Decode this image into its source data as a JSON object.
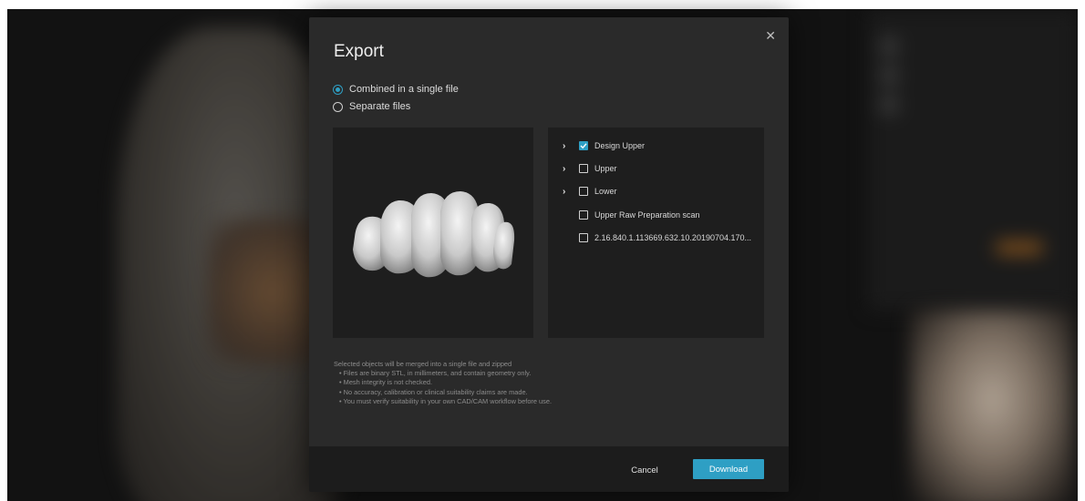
{
  "dialog": {
    "title": "Export",
    "close_icon": "close-icon",
    "export_mode": {
      "options": [
        {
          "label": "Combined in a single file",
          "selected": true
        },
        {
          "label": "Separate files",
          "selected": false
        }
      ]
    },
    "objects": [
      {
        "label": "Design Upper",
        "checked": true,
        "expandable": true
      },
      {
        "label": "Upper",
        "checked": false,
        "expandable": true
      },
      {
        "label": "Lower",
        "checked": false,
        "expandable": true
      },
      {
        "label": "Upper Raw Preparation scan",
        "checked": false,
        "expandable": false
      },
      {
        "label": "2.16.840.1.113669.632.10.20190704.170...",
        "checked": false,
        "expandable": false
      }
    ],
    "notes": {
      "intro": "Selected objects will be merged into a single file and zipped",
      "bullets": [
        "Files are binary STL, in millimeters, and contain geometry only.",
        "Mesh integrity is not checked.",
        "No accuracy, calibration or clinical suitability claims are made.",
        "You must verify suitability in your own CAD/CAM workflow before use."
      ]
    },
    "footer": {
      "cancel_label": "Cancel",
      "download_label": "Download"
    }
  },
  "colors": {
    "accent": "#2e9fc4",
    "dialog_bg": "#2a2a2a",
    "panel_bg": "#1e1e1e",
    "footer_bg": "#1c1c1c"
  }
}
